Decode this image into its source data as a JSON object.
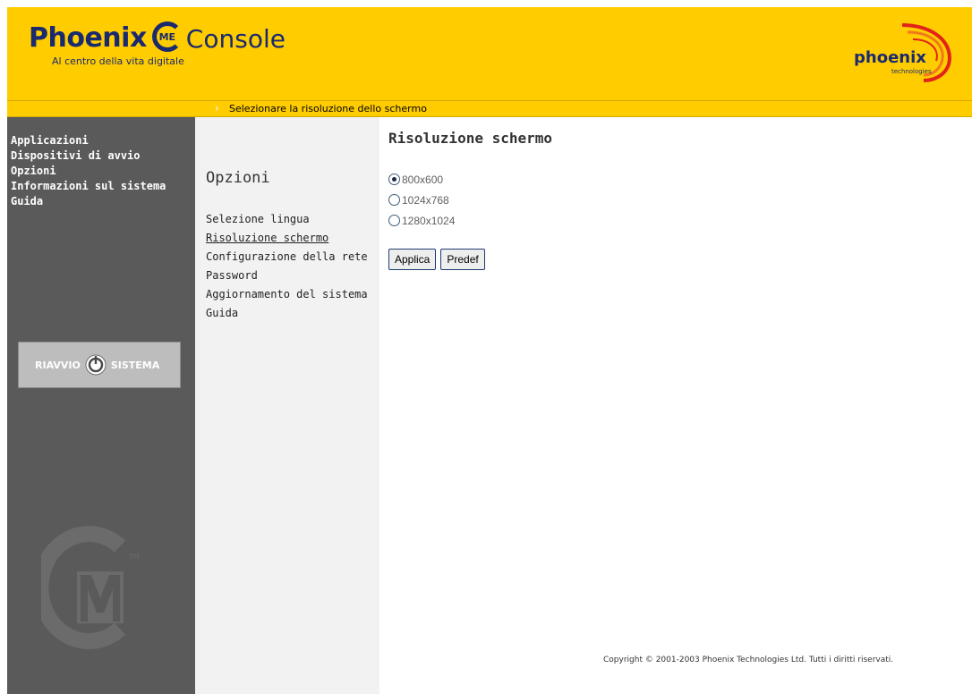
{
  "header": {
    "brand": "Phoenix",
    "badge": "ME",
    "product": "Console",
    "tagline": "Al centro della vita digitale",
    "logo_text": "phoenix",
    "logo_sub": "technologies"
  },
  "subbar": {
    "text": "Selezionare la risoluzione dello schermo"
  },
  "sidebar": {
    "items": [
      {
        "label": "Applicazioni"
      },
      {
        "label": "Dispositivi di avvio"
      },
      {
        "label": "Opzioni"
      },
      {
        "label": "Informazioni sul sistema"
      },
      {
        "label": "Guida"
      }
    ],
    "restart": {
      "left": "RIAVVIO",
      "right": "SISTEMA"
    }
  },
  "options": {
    "title": "Opzioni",
    "items": [
      {
        "label": "Selezione lingua"
      },
      {
        "label": "Risoluzione schermo"
      },
      {
        "label": "Configurazione della rete"
      },
      {
        "label": "Password"
      },
      {
        "label": "Aggiornamento del sistema"
      },
      {
        "label": "Guida"
      }
    ],
    "active": "Risoluzione schermo"
  },
  "main": {
    "title": "Risoluzione schermo",
    "resolutions": [
      {
        "label": "800x600",
        "selected": true
      },
      {
        "label": "1024x768",
        "selected": false
      },
      {
        "label": "1280x1024",
        "selected": false
      }
    ],
    "apply_label": "Applica",
    "default_label": "Predef"
  },
  "footer": {
    "copyright": "Copyright © 2001-2003 Phoenix Technologies Ltd. Tutti i diritti riservati."
  },
  "colors": {
    "header_yellow": "#ffcc00",
    "brand_navy": "#1a2a6e",
    "sidebar_gray": "#5a5a5a",
    "logo_red": "#e2231a"
  }
}
